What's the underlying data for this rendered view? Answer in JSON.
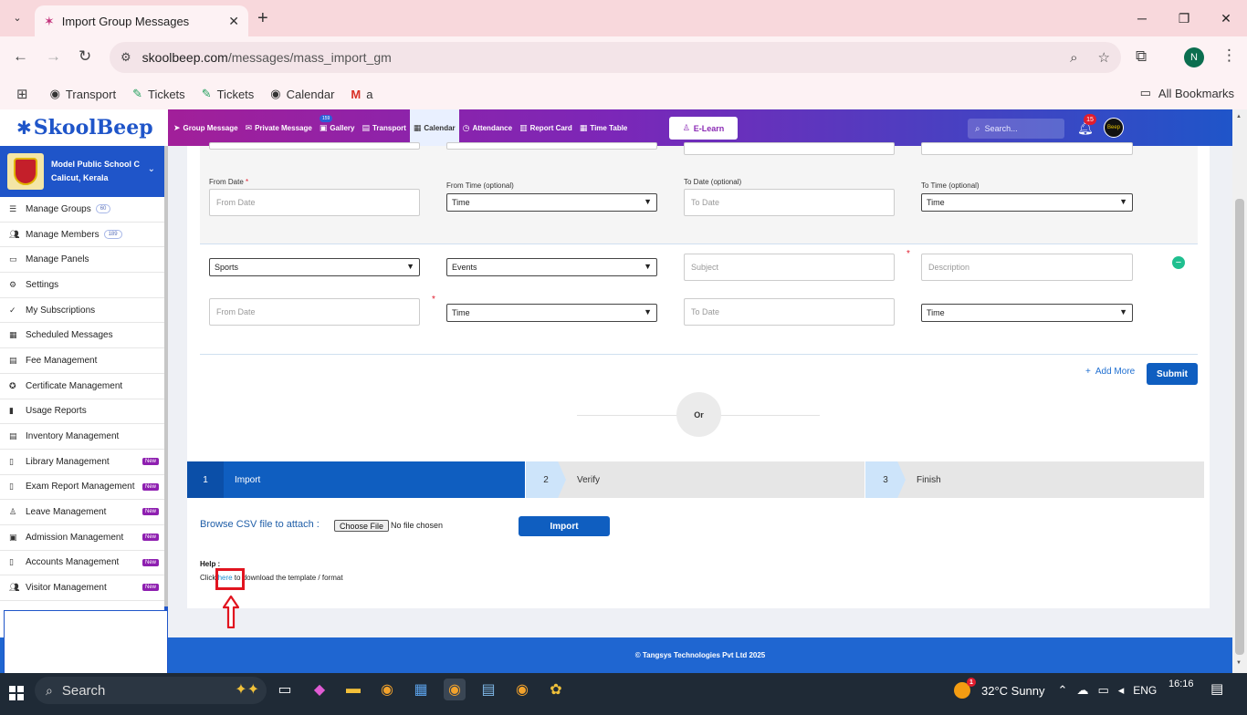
{
  "browser": {
    "tab_title": "Import Group Messages",
    "url_host": "skoolbeep.com",
    "url_path": "/messages/mass_import_gm",
    "profile_initial": "N",
    "bookmarks": [
      {
        "label": "Transport"
      },
      {
        "label": "Tickets"
      },
      {
        "label": "Tickets"
      },
      {
        "label": "Calendar"
      },
      {
        "label": "a"
      }
    ],
    "all_bookmarks": "All Bookmarks"
  },
  "app": {
    "logo_text": "SkoolBeep",
    "nav": [
      {
        "label": "Group Message"
      },
      {
        "label": "Private Message"
      },
      {
        "label": "Gallery"
      },
      {
        "label": "Transport"
      },
      {
        "label": "Calendar"
      },
      {
        "label": "Attendance"
      },
      {
        "label": "Report Card"
      },
      {
        "label": "Time Table"
      }
    ],
    "private_badge": "159",
    "elearn": "E-Learn",
    "search_placeholder": "Search...",
    "notifications": "15",
    "avatar_text": "Beep"
  },
  "sidebar": {
    "school_name": "Model Public School C",
    "school_location": "Calicut, Kerala",
    "items": [
      {
        "label": "Manage Groups",
        "count": "60"
      },
      {
        "label": "Manage Members",
        "count": "189"
      },
      {
        "label": "Manage Panels"
      },
      {
        "label": "Settings"
      },
      {
        "label": "My Subscriptions"
      },
      {
        "label": "Scheduled Messages"
      },
      {
        "label": "Fee Management"
      },
      {
        "label": "Certificate Management"
      },
      {
        "label": "Usage Reports"
      },
      {
        "label": "Inventory Management"
      },
      {
        "label": "Library Management",
        "badge": "New"
      },
      {
        "label": "Exam Report Management",
        "badge": "New"
      },
      {
        "label": "Leave Management",
        "badge": "New"
      },
      {
        "label": "Admission Management",
        "badge": "New"
      },
      {
        "label": "Accounts Management",
        "badge": "New"
      },
      {
        "label": "Visitor Management",
        "badge": "New"
      }
    ]
  },
  "form": {
    "row1_labels": {
      "from_date": "From Date",
      "from_time": "From Time (optional)",
      "to_date": "To Date (optional)",
      "to_time": "To Time (optional)"
    },
    "row1": {
      "from_date_ph": "From Date",
      "from_time": "Time",
      "to_date_ph": "To Date",
      "to_time": "Time"
    },
    "row2": {
      "category": "Sports",
      "type": "Events",
      "subject_ph": "Subject",
      "description_ph": "Description"
    },
    "row3": {
      "from_date_ph": "From Date",
      "from_time": "Time",
      "to_date_ph": "To Date",
      "to_time": "Time"
    },
    "required_mark": "*",
    "add_more": "Add More",
    "submit": "Submit",
    "or": "Or"
  },
  "steps": [
    {
      "num": "1",
      "label": "Import"
    },
    {
      "num": "2",
      "label": "Verify"
    },
    {
      "num": "3",
      "label": "Finish"
    }
  ],
  "import": {
    "browse_label": "Browse CSV file to attach :",
    "choose_file": "Choose File",
    "no_file": "No file chosen",
    "import_btn": "Import",
    "help_title": "Help :",
    "help_prefix": "Click ",
    "help_link": "here",
    "help_suffix": " to download the template / format"
  },
  "footer": "© Tangsys Technologies Pvt Ltd 2025",
  "taskbar": {
    "search": "Search",
    "weather_badge": "1",
    "weather": "32°C  Sunny",
    "lang": "ENG",
    "time": "16:16"
  },
  "colors": {
    "primary": "#0f5ec0",
    "header_start": "#b01c8e",
    "header_end": "#1f55c9",
    "highlight": "#e1141f",
    "new_badge": "#8e1fb0"
  }
}
